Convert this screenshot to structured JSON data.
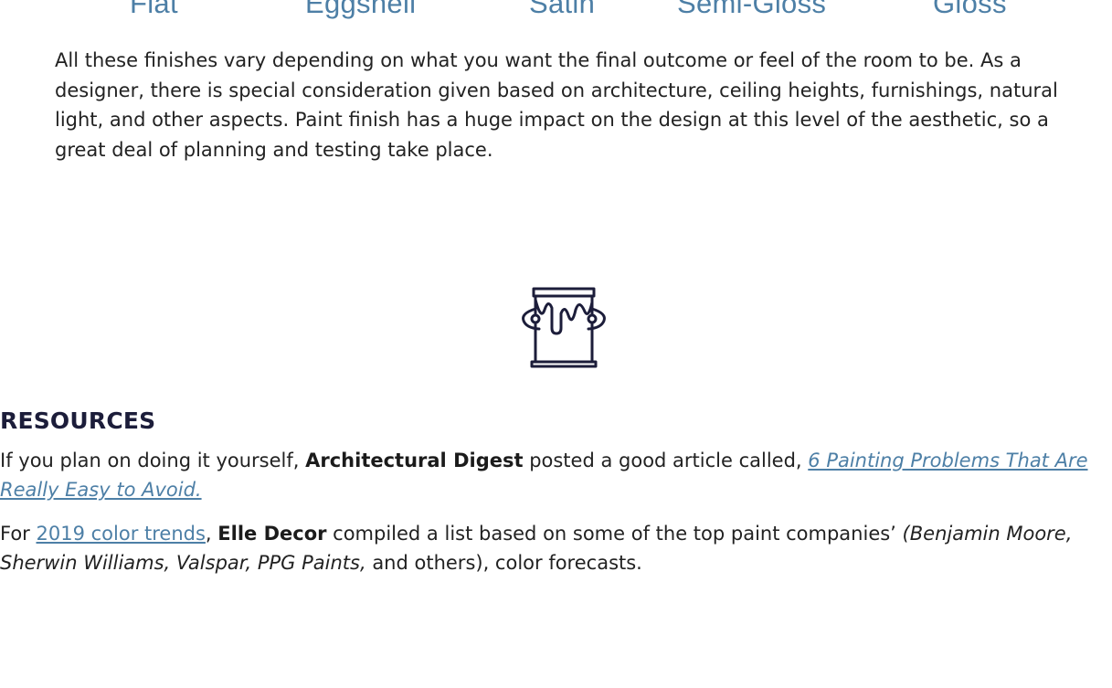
{
  "finishes": [
    "Flat",
    "Eggshell",
    "Satin",
    "Semi-Gloss",
    "Gloss"
  ],
  "intro": {
    "paragraph": "All these finishes vary depending on what you want the final outcome or feel of the room to be.  As a designer, there is special consideration given based on architecture, ceiling heights, furnishings, natural light, and other aspects.  Paint finish has a huge impact on the design at this level of the aesthetic, so a great deal of planning and testing take place."
  },
  "icon": {
    "name": "paint-can-icon",
    "color": "#1c1d3a"
  },
  "resources": {
    "heading": "RESOURCES",
    "para1": {
      "prefix": "If you plan on doing it yourself, ",
      "source": "Architectural Digest",
      "middle": " posted a good article called, ",
      "link_text": "6 Painting Problems That Are Really Easy to Avoid."
    },
    "para2": {
      "prefix": "For ",
      "link_text": "2019 color trends",
      "comma": ", ",
      "source": "Elle Decor",
      "middle": " compiled a list based on some of the top paint companies’ ",
      "companies": "(Benjamin Moore, Sherwin Williams, Valspar, PPG Paints,",
      "suffix": " and others), color forecasts."
    }
  },
  "colors": {
    "accent": "#4d7fa6",
    "heading": "#1c1d3a",
    "text": "#222222"
  }
}
